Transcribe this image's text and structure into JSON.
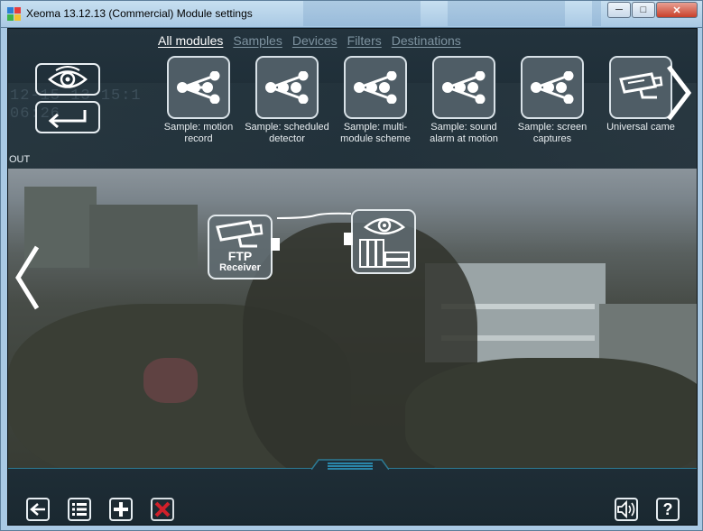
{
  "window": {
    "title": "Xeoma 13.12.13 (Commercial) Module settings",
    "minimize_icon": "minimize-icon",
    "maximize_icon": "maximize-icon",
    "close_icon": "close-icon"
  },
  "tabs": [
    {
      "label": "All modules",
      "active": true
    },
    {
      "label": "Samples",
      "active": false
    },
    {
      "label": "Devices",
      "active": false
    },
    {
      "label": "Filters",
      "active": false
    },
    {
      "label": "Destinations",
      "active": false
    }
  ],
  "modules": [
    {
      "label": "Sample: motion record",
      "icon": "sample-scheme-icon"
    },
    {
      "label": "Sample: scheduled detector",
      "icon": "sample-scheme-icon"
    },
    {
      "label": "Sample: multi-module scheme",
      "icon": "sample-scheme-icon"
    },
    {
      "label": "Sample: sound alarm at motion",
      "icon": "sample-scheme-icon"
    },
    {
      "label": "Sample: screen captures",
      "icon": "sample-scheme-icon"
    },
    {
      "label": "Universal came",
      "icon": "camera-icon"
    }
  ],
  "controls": {
    "view_icon": "eye-icon",
    "back_icon": "return-arrow-icon",
    "next_icon": "chevron-right-icon",
    "prev_icon": "chevron-left-icon"
  },
  "background_text": {
    "line1": "12-15-13 15:1",
    "line2": "06:26"
  },
  "out_label": "OUT",
  "scheme_nodes": {
    "ftp": {
      "line1": "FTP",
      "line2": "Receiver"
    },
    "preview": {
      "icon": "preview-archive-icon"
    }
  },
  "bottom_bar": {
    "back_icon": "back-arrow-icon",
    "list_icon": "list-icon",
    "add_icon": "plus-icon",
    "delete_icon": "delete-x-icon",
    "sound_icon": "speaker-icon",
    "help_icon": "help-icon",
    "help_label": "?"
  },
  "colors": {
    "accent": "#2d7a94",
    "delete_red": "#d0202a",
    "panel_bg": "#1d2b34"
  }
}
